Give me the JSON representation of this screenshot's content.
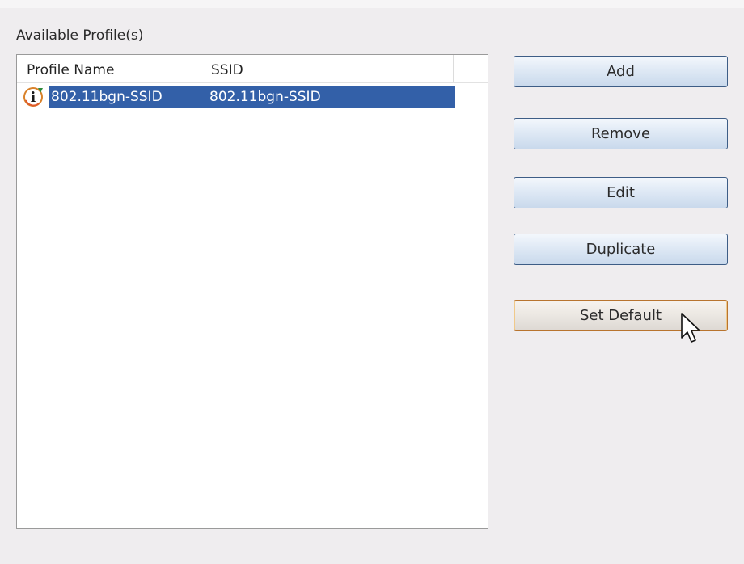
{
  "group": {
    "label": "Available Profile(s)"
  },
  "table": {
    "columns": [
      "Profile Name",
      "SSID"
    ],
    "rows": [
      {
        "icon": "default-profile-icon",
        "profile_name": "802.11bgn-SSID",
        "ssid": "802.11bgn-SSID",
        "selected": true
      }
    ]
  },
  "buttons": {
    "add": "Add",
    "remove": "Remove",
    "edit": "Edit",
    "duplicate": "Duplicate",
    "set_default": "Set Default"
  },
  "colors": {
    "selection": "#3360a8",
    "button_border": "#3d5d86",
    "focus_border": "#b8742e",
    "background": "#efedef"
  }
}
